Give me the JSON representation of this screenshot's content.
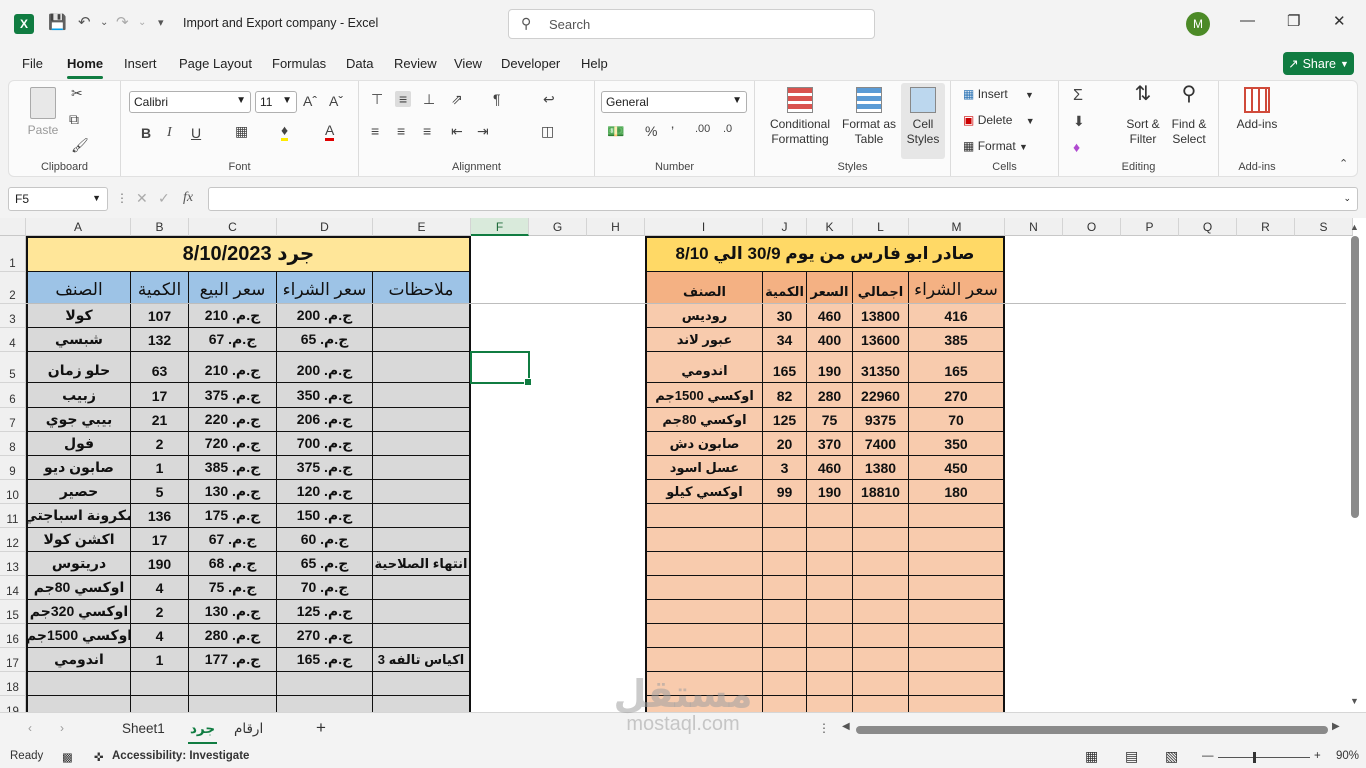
{
  "app": {
    "title": "Import and Export company  -  Excel",
    "search_placeholder": "Search",
    "avatar_initial": "M",
    "logo": "X"
  },
  "menu": {
    "tabs": [
      "File",
      "Home",
      "Insert",
      "Page Layout",
      "Formulas",
      "Data",
      "Review",
      "View",
      "Developer",
      "Help"
    ],
    "active": "Home",
    "share_label": "Share"
  },
  "ribbon": {
    "clipboard": {
      "label": "Clipboard",
      "paste": "Paste"
    },
    "font": {
      "label": "Font",
      "name": "Calibri",
      "size": "11",
      "bold": "B",
      "italic": "I",
      "underline": "U"
    },
    "alignment": {
      "label": "Alignment"
    },
    "number": {
      "label": "Number",
      "format": "General"
    },
    "styles": {
      "label": "Styles",
      "conditional": [
        "Conditional",
        "Formatting"
      ],
      "format_table": [
        "Format as",
        "Table"
      ],
      "cell_styles": [
        "Cell",
        "Styles"
      ]
    },
    "cells": {
      "label": "Cells",
      "insert": "Insert",
      "delete": "Delete",
      "format": "Format"
    },
    "editing": {
      "label": "Editing",
      "sort": [
        "Sort &",
        "Filter"
      ],
      "find": [
        "Find &",
        "Select"
      ]
    },
    "addins": {
      "label": "Add-ins",
      "button": "Add-ins"
    }
  },
  "formula_bar": {
    "name_box": "F5",
    "fx": "fx",
    "content": ""
  },
  "columns": [
    "A",
    "B",
    "C",
    "D",
    "E",
    "F",
    "G",
    "H",
    "I",
    "J",
    "K",
    "L",
    "M",
    "N",
    "O",
    "P",
    "Q",
    "R",
    "S"
  ],
  "rows": [
    "1",
    "2",
    "3",
    "4",
    "5",
    "6",
    "7",
    "8",
    "9",
    "10",
    "11",
    "12",
    "13",
    "14",
    "15",
    "16",
    "17",
    "18",
    "19"
  ],
  "table1": {
    "title": "جرد 8/10/2023",
    "headers": {
      "item": "الصنف",
      "qty": "الكمية",
      "sell": "سعر البيع",
      "buy": "سعر الشراء",
      "notes": "ملاحظات"
    },
    "rows": [
      {
        "item": "كولا",
        "qty": "107",
        "sell": "ج.م. 210",
        "buy": "ج.م. 200",
        "notes": ""
      },
      {
        "item": "شبسي",
        "qty": "132",
        "sell": "ج.م. 67",
        "buy": "ج.م. 65",
        "notes": ""
      },
      {
        "item": "حلو زمان",
        "qty": "63",
        "sell": "ج.م. 210",
        "buy": "ج.م. 200",
        "notes": ""
      },
      {
        "item": "زبيب",
        "qty": "17",
        "sell": "ج.م. 375",
        "buy": "ج.م. 350",
        "notes": ""
      },
      {
        "item": "بيبي جوي",
        "qty": "21",
        "sell": "ج.م. 220",
        "buy": "ج.م. 206",
        "notes": ""
      },
      {
        "item": "فول",
        "qty": "2",
        "sell": "ج.م. 720",
        "buy": "ج.م. 700",
        "notes": ""
      },
      {
        "item": "صابون ديو",
        "qty": "1",
        "sell": "ج.م. 385",
        "buy": "ج.م. 375",
        "notes": ""
      },
      {
        "item": "حصير",
        "qty": "5",
        "sell": "ج.م. 130",
        "buy": "ج.م. 120",
        "notes": ""
      },
      {
        "item": "مكرونة اسباجتي",
        "qty": "136",
        "sell": "ج.م. 175",
        "buy": "ج.م. 150",
        "notes": ""
      },
      {
        "item": "اكشن كولا",
        "qty": "17",
        "sell": "ج.م. 67",
        "buy": "ج.م. 60",
        "notes": ""
      },
      {
        "item": "دريتوس",
        "qty": "190",
        "sell": "ج.م. 68",
        "buy": "ج.م. 65",
        "notes": "انتهاء الصلاحية"
      },
      {
        "item": "اوكسي 80جم",
        "qty": "4",
        "sell": "ج.م. 75",
        "buy": "ج.م. 70",
        "notes": ""
      },
      {
        "item": "اوكسي 320جم",
        "qty": "2",
        "sell": "ج.م. 130",
        "buy": "ج.م. 125",
        "notes": ""
      },
      {
        "item": "اوكسي 1500جم",
        "qty": "4",
        "sell": "ج.م. 280",
        "buy": "ج.م. 270",
        "notes": ""
      },
      {
        "item": "اندومي",
        "qty": "1",
        "sell": "ج.م. 177",
        "buy": "ج.م. 165",
        "notes": "اكياس تالفه 3"
      }
    ]
  },
  "table2": {
    "title": "صادر ابو فارس من يوم 30/9 الي 8/10",
    "headers": {
      "item": "الصنف",
      "qty": "الكمية",
      "price": "السعر",
      "total": "اجمالي",
      "buy": "سعر الشراء"
    },
    "rows": [
      {
        "item": "روديس",
        "qty": "30",
        "price": "460",
        "total": "13800",
        "buy": "416"
      },
      {
        "item": "عبور لاند",
        "qty": "34",
        "price": "400",
        "total": "13600",
        "buy": "385"
      },
      {
        "item": "اندومي",
        "qty": "165",
        "price": "190",
        "total": "31350",
        "buy": "165"
      },
      {
        "item": "اوكسي 1500جم",
        "qty": "82",
        "price": "280",
        "total": "22960",
        "buy": "270"
      },
      {
        "item": "اوكسي 80جم",
        "qty": "125",
        "price": "75",
        "total": "9375",
        "buy": "70"
      },
      {
        "item": "صابون دش",
        "qty": "20",
        "price": "370",
        "total": "7400",
        "buy": "350"
      },
      {
        "item": "عسل اسود",
        "qty": "3",
        "price": "460",
        "total": "1380",
        "buy": "450"
      },
      {
        "item": "اوكسي كيلو",
        "qty": "99",
        "price": "190",
        "total": "18810",
        "buy": "180"
      }
    ]
  },
  "sheets": {
    "tabs": [
      "Sheet1",
      "جرد",
      "ارقام"
    ],
    "active": "جرد",
    "add": "+"
  },
  "status": {
    "ready": "Ready",
    "accessibility": "Accessibility: Investigate",
    "zoom": "90%"
  },
  "watermark": {
    "line1": "مستقل",
    "line2": "mostaql.com"
  },
  "colors": {
    "accent": "#107c41",
    "title1_bg": "#ffe699",
    "header1_bg": "#9dc3e6",
    "body1_bg": "#d9d9d9",
    "title2_bg": "#ffd966",
    "header2_bg": "#f4b183",
    "body2_bg": "#f8cbad"
  }
}
